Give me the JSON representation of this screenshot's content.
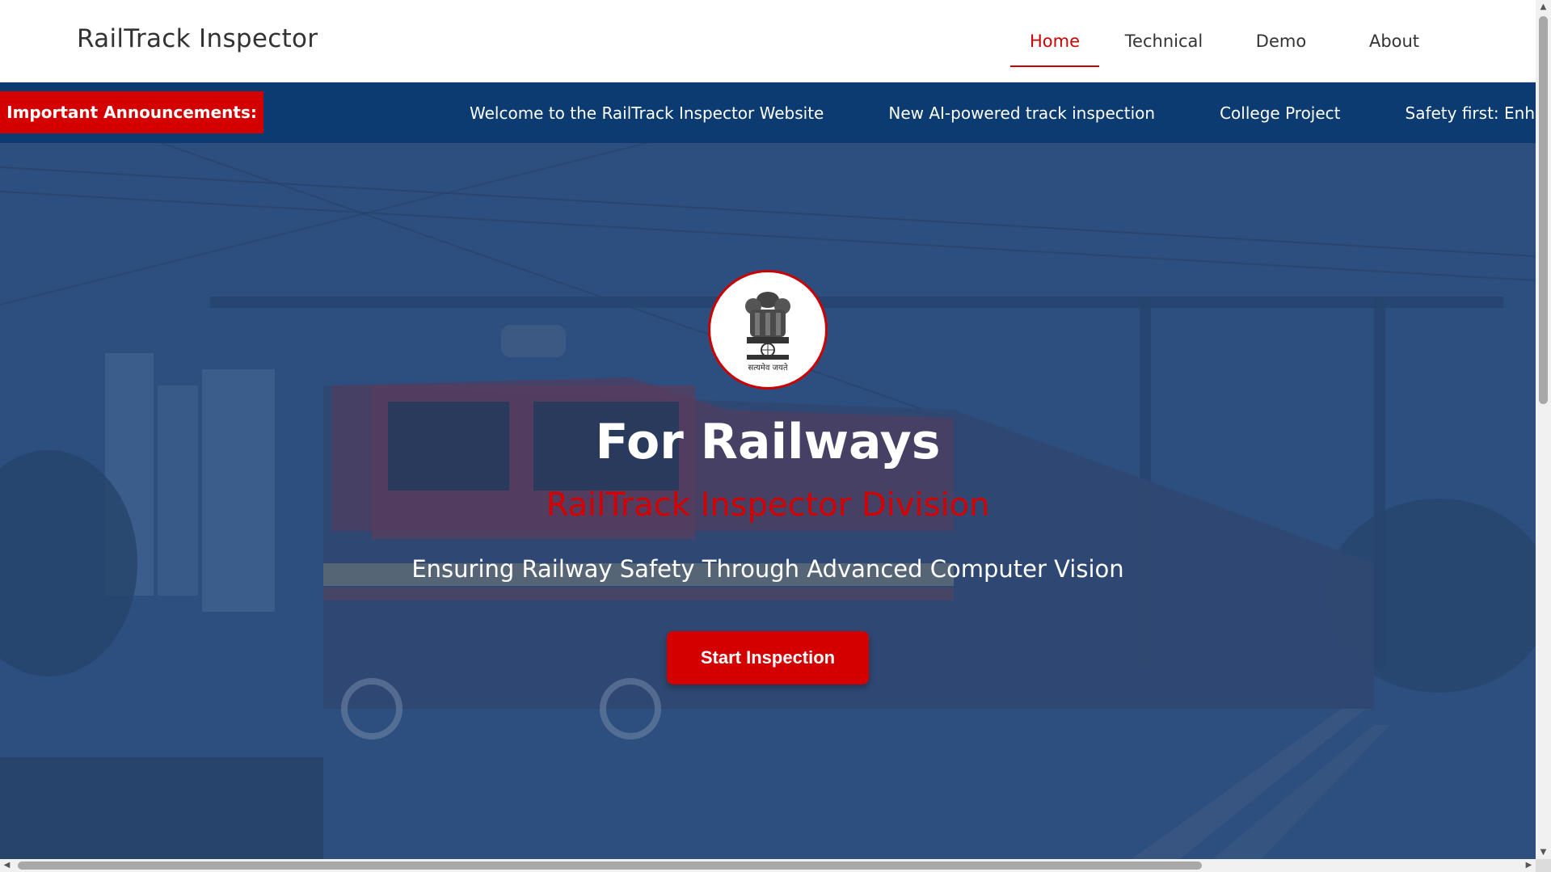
{
  "header": {
    "brand": "RailTrack Inspector",
    "nav": [
      {
        "label": "Home",
        "active": true
      },
      {
        "label": "Technical",
        "active": false
      },
      {
        "label": "Demo",
        "active": false
      },
      {
        "label": "About",
        "active": false
      }
    ]
  },
  "announcements": {
    "label": "Important Announcements:",
    "items": [
      "Welcome to the RailTrack Inspector Website",
      "New AI-powered track inspection",
      "College Project",
      "Safety first: Enh"
    ]
  },
  "hero": {
    "emblem_icon": "national-emblem-icon",
    "emblem_motto": "सत्यमेव जयते",
    "title": "For Railways",
    "subtitle": "RailTrack Inspector Division",
    "description": "Ensuring Railway Safety Through Advanced Computer Vision",
    "cta_label": "Start Inspection"
  },
  "colors": {
    "accent_red": "#d40000",
    "nav_active": "#cc0000",
    "announce_bar": "#0b3b71",
    "hero_overlay": "#2f5080"
  }
}
